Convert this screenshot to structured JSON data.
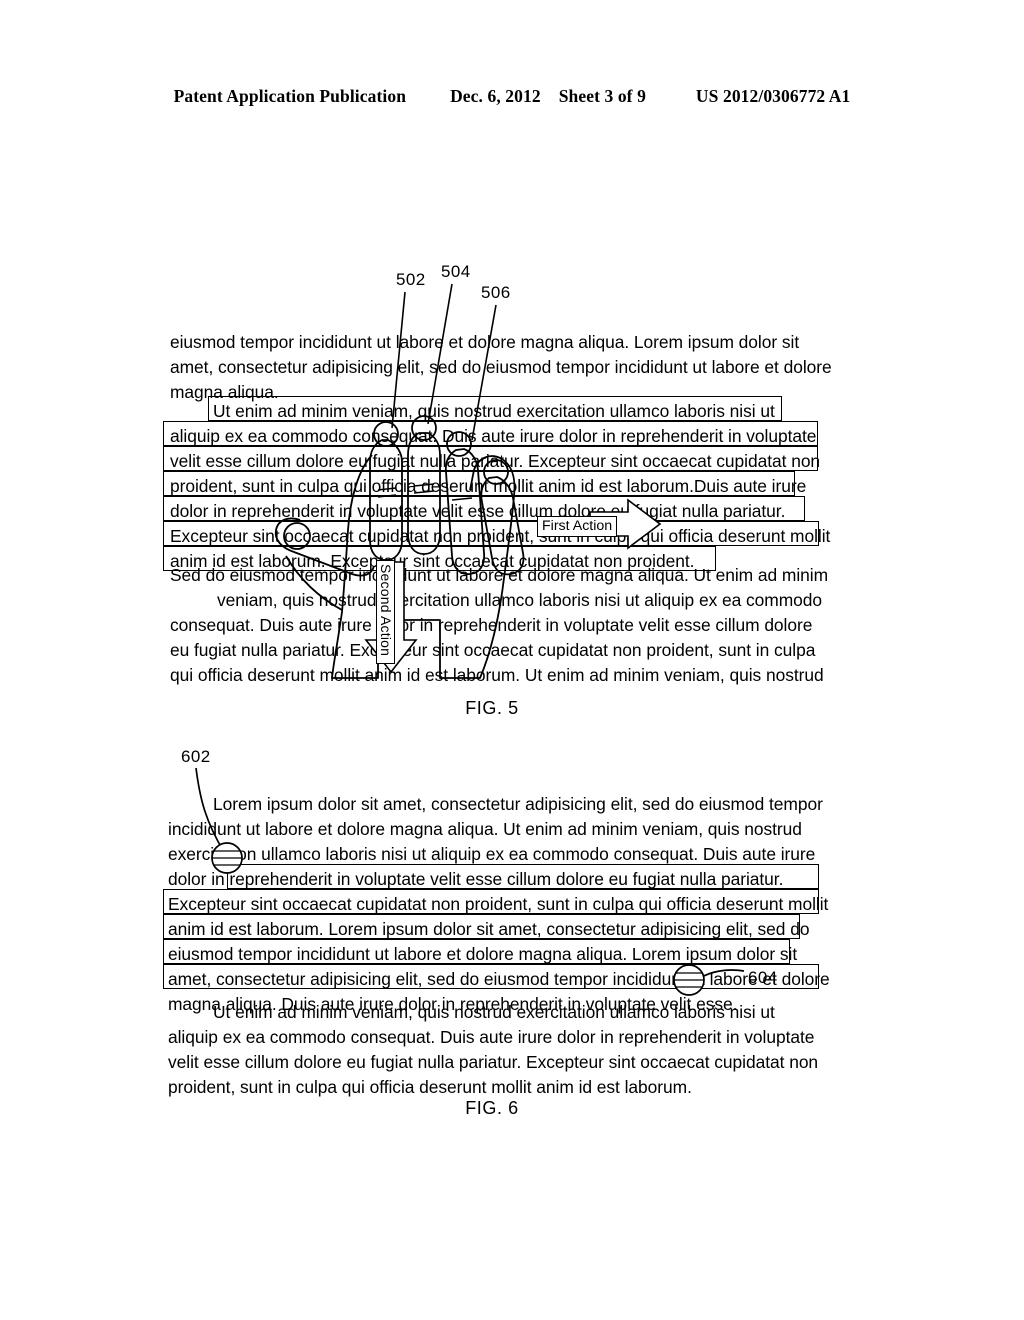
{
  "header": {
    "publication": "Patent Application Publication",
    "date": "Dec. 6, 2012",
    "sheet": "Sheet 3 of 9",
    "number": "US 2012/0306772 A1"
  },
  "fig5": {
    "label": "FIG. 5",
    "refs": [
      {
        "id": "502",
        "label": "502"
      },
      {
        "id": "504",
        "label": "504"
      },
      {
        "id": "506",
        "label": "506"
      }
    ],
    "intro_lines": [
      "eiusmod tempor incididunt ut labore et dolore magna aliqua. Lorem ipsum dolor sit",
      "amet, consectetur adipisicing elit, sed do eiusmod tempor incididunt ut labore et dolore",
      "magna aliqua."
    ],
    "selected_lines": [
      "Ut enim ad minim veniam, quis nostrud exercitation ullamco laboris nisi ut",
      "aliquip ex ea commodo consequat. Duis aute irure dolor in reprehenderit in voluptate",
      "velit esse cillum dolore eu fugiat nulla pariatur. Excepteur sint occaecat cupidatat non",
      "proident, sunt in culpa qui officia deserunt mollit anim id est laborum.Duis aute irure",
      "dolor in reprehenderit in voluptate velit esse cillum dolore eu fugiat nulla pariatur.",
      "Excepteur sint occaecat cupidatat non proident, sunt in culpa qui officia deserunt mollit",
      "anim id est laborum. Excepteur sint occaecat cupidatat non proident."
    ],
    "tail_lines": [
      "Sed do eiusmod tempor incididunt ut labore et dolore magna aliqua. Ut enim ad minim",
      "veniam, quis nostrud exercitation ullamco laboris nisi ut aliquip ex ea commodo",
      "consequat. Duis aute irure dolor in reprehenderit in voluptate velit esse cillum dolore",
      "eu fugiat nulla pariatur. Excepteur sint occaecat cupidatat non proident, sunt in culpa",
      "qui officia deserunt mollit anim id est laborum. Ut enim ad minim veniam, quis nostrud"
    ],
    "first_action_label": "First Action",
    "second_action_label": "Second Action"
  },
  "fig6": {
    "label": "FIG. 6",
    "refs": [
      {
        "id": "602",
        "label": "602"
      },
      {
        "id": "604",
        "label": "604"
      }
    ],
    "intro_lines": [
      "Lorem ipsum dolor sit amet, consectetur adipisicing elit, sed do eiusmod tempor",
      "incididunt ut labore et dolore magna aliqua. Ut enim ad minim veniam, quis nostrud",
      "exercitation ullamco laboris nisi ut aliquip ex ea commodo consequat. Duis aute irure",
      "dolor in reprehenderit in voluptate velit esse cillum dolore eu fugiat nulla pariatur."
    ],
    "selected_lines": [
      "Excepteur sint occaecat cupidatat non proident, sunt in culpa qui officia deserunt mollit",
      "anim id est laborum. Lorem ipsum dolor sit amet, consectetur adipisicing elit, sed do",
      "eiusmod tempor incididunt ut labore et dolore magna aliqua. Lorem ipsum dolor sit",
      "amet, consectetur adipisicing elit, sed do eiusmod tempor incididunt ut labore et dolore",
      "magna aliqua. Duis aute irure dolor in reprehenderit in voluptate velit esse."
    ],
    "tail_lines": [
      "Ut enim ad minim veniam, quis nostrud exercitation ullamco laboris nisi ut",
      "aliquip ex ea commodo consequat. Duis aute irure dolor in reprehenderit in voluptate",
      "velit esse cillum dolore eu fugiat nulla pariatur. Excepteur sint occaecat cupidatat non",
      "proident, sunt in culpa qui officia deserunt mollit anim id est laborum."
    ]
  }
}
